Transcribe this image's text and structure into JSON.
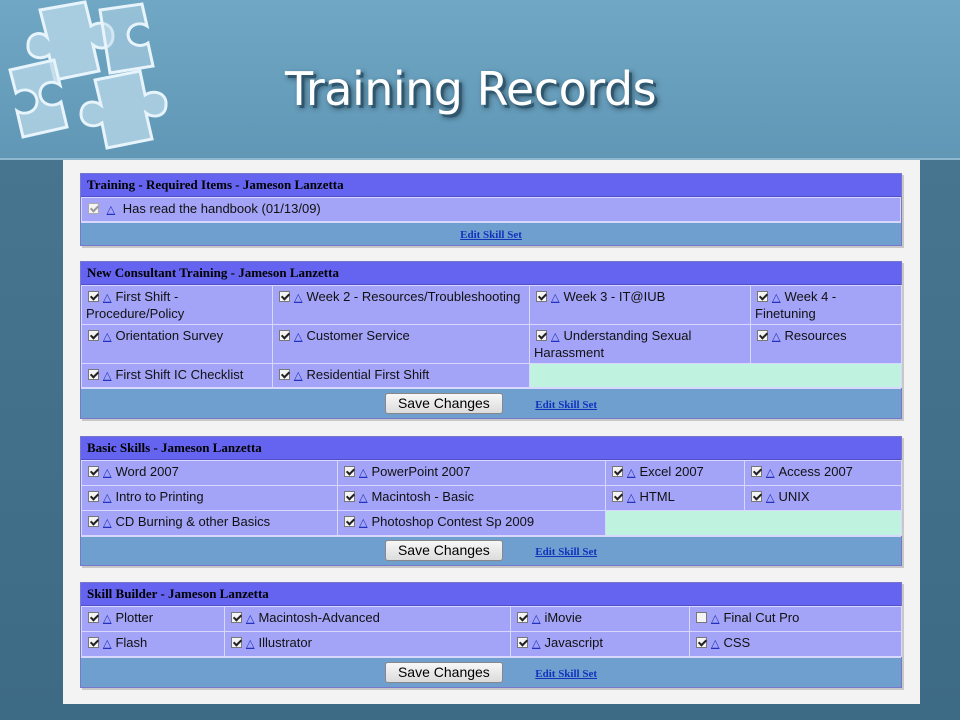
{
  "title": "Training Records",
  "colors": {
    "section_header": "#6464f0",
    "cell_bg": "#a3a3f8",
    "empty_cell_bg": "#bff3df",
    "footer_bg": "#6f9fcf",
    "link": "#1133bb"
  },
  "icons": {
    "item_icon": "triangle-icon",
    "decoration": "puzzle-pieces"
  },
  "triangle_glyph": "△",
  "sections": [
    {
      "heading": "Training - Required Items - Jameson Lanzetta",
      "rows": [
        [
          {
            "label": "Has read the handbook (01/13/09)",
            "checked": true,
            "disabled": true
          }
        ]
      ],
      "footer": {
        "save_label": "",
        "edit_link": "Edit Skill Set"
      }
    },
    {
      "heading": "New Consultant Training - Jameson Lanzetta",
      "rows": [
        [
          {
            "label": "First Shift - Procedure/Policy",
            "checked": true
          },
          {
            "label": "Week 2 - Resources/Troubleshooting",
            "checked": true
          },
          {
            "label": "Week 3 - IT@IUB",
            "checked": true
          },
          {
            "label": "Week 4 - Finetuning",
            "checked": true
          }
        ],
        [
          {
            "label": "Orientation Survey",
            "checked": true
          },
          {
            "label": "Customer Service",
            "checked": true
          },
          {
            "label": "Understanding Sexual Harassment",
            "checked": true
          },
          {
            "label": "Resources",
            "checked": true
          }
        ],
        [
          {
            "label": "First Shift IC Checklist",
            "checked": true
          },
          {
            "label": "Residential First Shift",
            "checked": true
          }
        ]
      ],
      "footer": {
        "save_label": "Save Changes",
        "edit_link": "Edit Skill Set"
      }
    },
    {
      "heading": "Basic Skills - Jameson Lanzetta",
      "rows": [
        [
          {
            "label": "Word 2007",
            "checked": true
          },
          {
            "label": "PowerPoint 2007",
            "checked": true
          },
          {
            "label": "Excel 2007",
            "checked": true
          },
          {
            "label": "Access 2007",
            "checked": true
          }
        ],
        [
          {
            "label": "Intro to Printing",
            "checked": true
          },
          {
            "label": "Macintosh - Basic",
            "checked": true
          },
          {
            "label": "HTML",
            "checked": true
          },
          {
            "label": "UNIX",
            "checked": true
          }
        ],
        [
          {
            "label": "CD Burning & other Basics",
            "checked": true
          },
          {
            "label": "Photoshop Contest Sp 2009",
            "checked": true
          }
        ]
      ],
      "footer": {
        "save_label": "Save Changes",
        "edit_link": "Edit Skill Set"
      }
    },
    {
      "heading": "Skill Builder - Jameson Lanzetta",
      "rows": [
        [
          {
            "label": "Plotter",
            "checked": true
          },
          {
            "label": "Macintosh-Advanced",
            "checked": true
          },
          {
            "label": "iMovie",
            "checked": true
          },
          {
            "label": "Final Cut Pro",
            "checked": false
          }
        ],
        [
          {
            "label": "Flash",
            "checked": true
          },
          {
            "label": "Illustrator",
            "checked": true
          },
          {
            "label": "Javascript",
            "checked": true
          },
          {
            "label": "CSS",
            "checked": true
          }
        ]
      ],
      "footer": {
        "save_label": "Save Changes",
        "edit_link": "Edit Skill Set"
      }
    }
  ]
}
